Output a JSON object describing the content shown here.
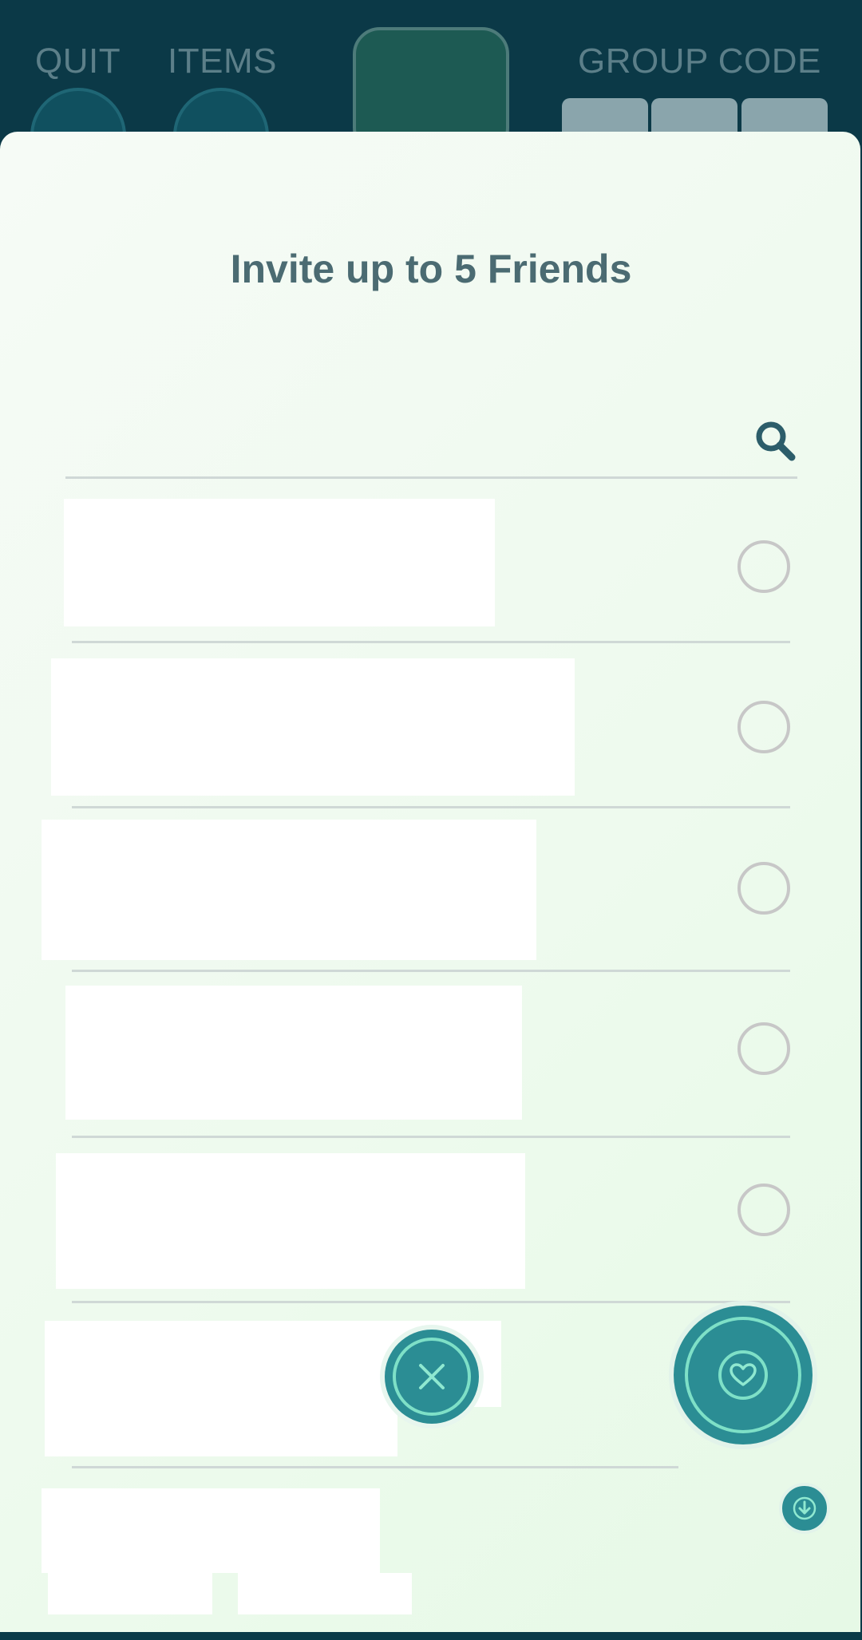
{
  "header": {
    "quit_label": "QUIT",
    "items_label": "ITEMS",
    "group_code_label": "GROUP CODE"
  },
  "sheet": {
    "title": "Invite up to 5 Friends",
    "search": {
      "value": "",
      "placeholder": ""
    },
    "friends": [
      {
        "selected": false
      },
      {
        "selected": false
      },
      {
        "selected": false
      },
      {
        "selected": false
      },
      {
        "selected": false
      },
      {
        "selected": false
      },
      {
        "selected": false
      }
    ]
  },
  "icons": {
    "search": "search-icon",
    "close": "close-icon",
    "heart": "heart-icon",
    "download": "download-arrow-icon"
  },
  "colors": {
    "accent": "#2b8d94",
    "accent_ring": "#7ee0c7",
    "title_text": "#4b6b72",
    "radio_border": "#c7c7c7",
    "top_bar": "#0b3947"
  }
}
